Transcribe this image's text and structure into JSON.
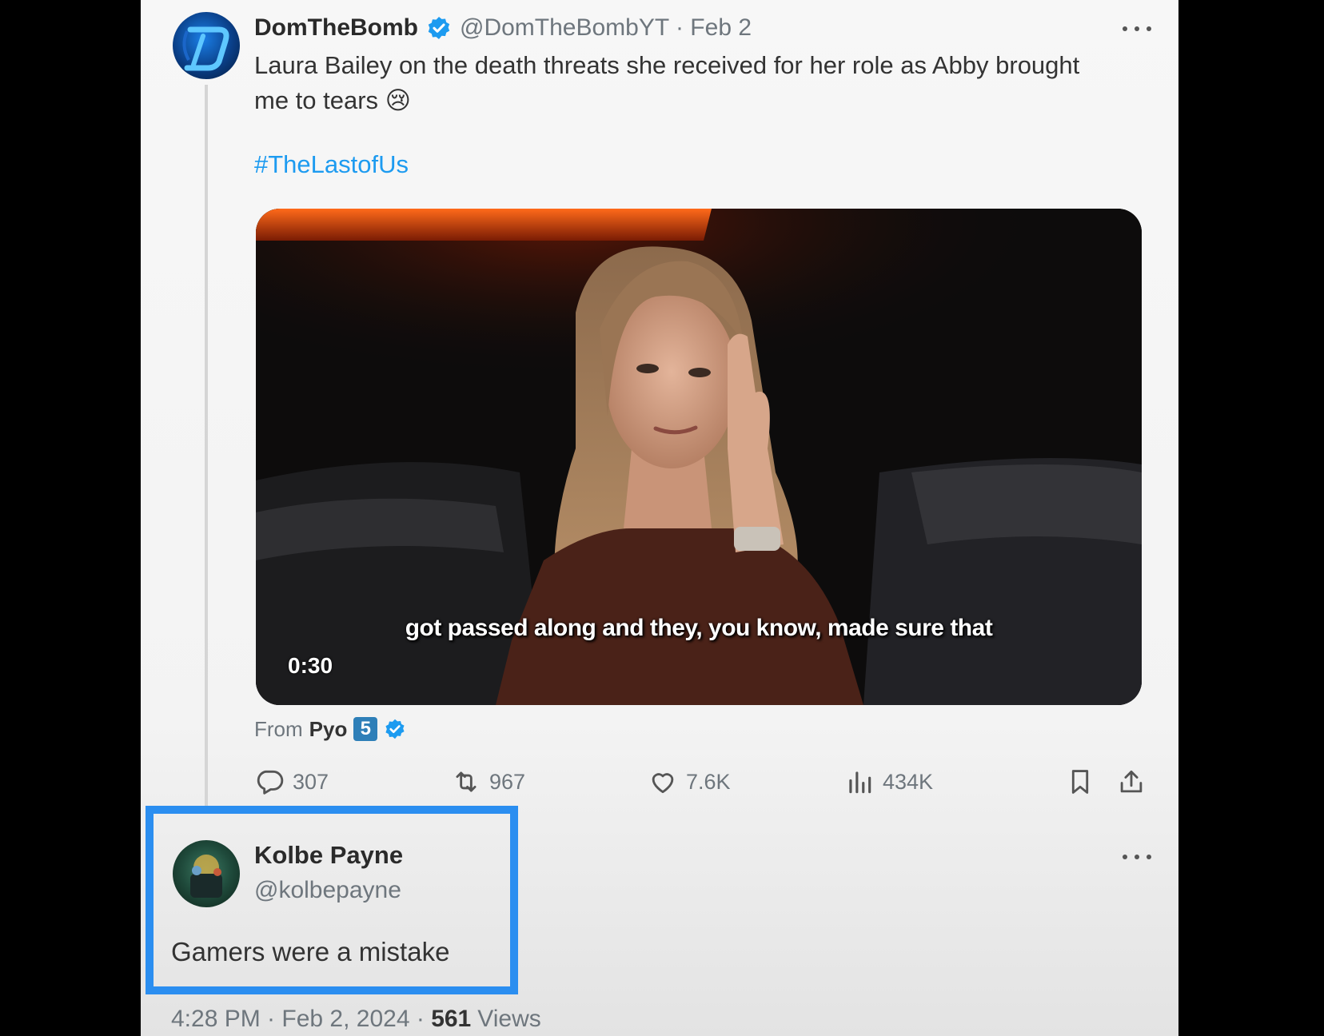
{
  "main_tweet": {
    "display_name": "DomTheBomb",
    "handle_date": "@DomTheBombYT · Feb 2",
    "text_line1": "Laura Bailey on the death threats she received for her role as Abby brought",
    "text_line2": "me to tears",
    "emoji": "😢",
    "hashtag": "#TheLastofUs",
    "video": {
      "subtitle": "got passed along and they, you know, made sure that",
      "duration": "0:30"
    },
    "from_label": "From",
    "from_name": "Pyo",
    "from_badge": "5",
    "actions": {
      "replies": "307",
      "reposts": "967",
      "likes": "7.6K",
      "views": "434K"
    }
  },
  "reply": {
    "display_name": "Kolbe Payne",
    "handle": "@kolbepayne",
    "text": "Gamers were a mistake",
    "time": "4:28 PM · Feb 2, 2024 ·",
    "views_count": "561",
    "views_label": "Views"
  },
  "colors": {
    "accent": "#1d9bf0",
    "highlight_border": "#2b8ef0",
    "muted_text": "#6e767d"
  },
  "icons": [
    "verified-badge-icon",
    "more-icon",
    "reply-icon",
    "repost-icon",
    "like-icon",
    "views-icon",
    "bookmark-icon",
    "share-icon"
  ]
}
